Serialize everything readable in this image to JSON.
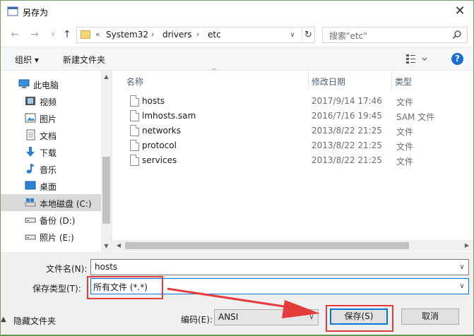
{
  "window": {
    "title": "另存为"
  },
  "address": {
    "overflow_marker": "«",
    "crumbs": [
      "System32",
      "drivers",
      "etc"
    ],
    "search_placeholder": "搜索\"etc\""
  },
  "toolbar": {
    "organize_label": "组织 ▾",
    "new_folder_label": "新建文件夹",
    "help_label": "?"
  },
  "nav": {
    "items": [
      {
        "label": "此电脑",
        "icon": "computer-icon"
      },
      {
        "label": "视频",
        "icon": "video-icon"
      },
      {
        "label": "图片",
        "icon": "pictures-icon"
      },
      {
        "label": "文档",
        "icon": "documents-icon"
      },
      {
        "label": "下载",
        "icon": "download-icon"
      },
      {
        "label": "音乐",
        "icon": "music-icon"
      },
      {
        "label": "桌面",
        "icon": "desktop-icon"
      },
      {
        "label": "本地磁盘 (C:)",
        "icon": "drive-icon",
        "selected": true
      },
      {
        "label": "备份 (D:)",
        "icon": "drive-icon"
      },
      {
        "label": "照片 (E:)",
        "icon": "drive-icon"
      }
    ]
  },
  "columns": {
    "name": "名称",
    "modified": "修改日期",
    "type": "类型"
  },
  "files": [
    {
      "name": "hosts",
      "modified": "2017/9/14 17:46",
      "type": "文件"
    },
    {
      "name": "lmhosts.sam",
      "modified": "2016/7/16 19:45",
      "type": "SAM 文件"
    },
    {
      "name": "networks",
      "modified": "2013/8/22 21:25",
      "type": "文件"
    },
    {
      "name": "protocol",
      "modified": "2013/8/22 21:25",
      "type": "文件"
    },
    {
      "name": "services",
      "modified": "2013/8/22 21:25",
      "type": "文件"
    }
  ],
  "form": {
    "filename_label": "文件名(N):",
    "filename_value": "hosts",
    "filetype_label": "保存类型(T):",
    "filetype_value": "所有文件  (*.*)",
    "encoding_label": "编码(E):",
    "encoding_value": "ANSI"
  },
  "buttons": {
    "hide_folders": "隐藏文件夹",
    "save": "保存(S)",
    "cancel": "取消"
  },
  "colors": {
    "annotation_red": "#e53b3b",
    "accent_blue": "#0078d7"
  }
}
